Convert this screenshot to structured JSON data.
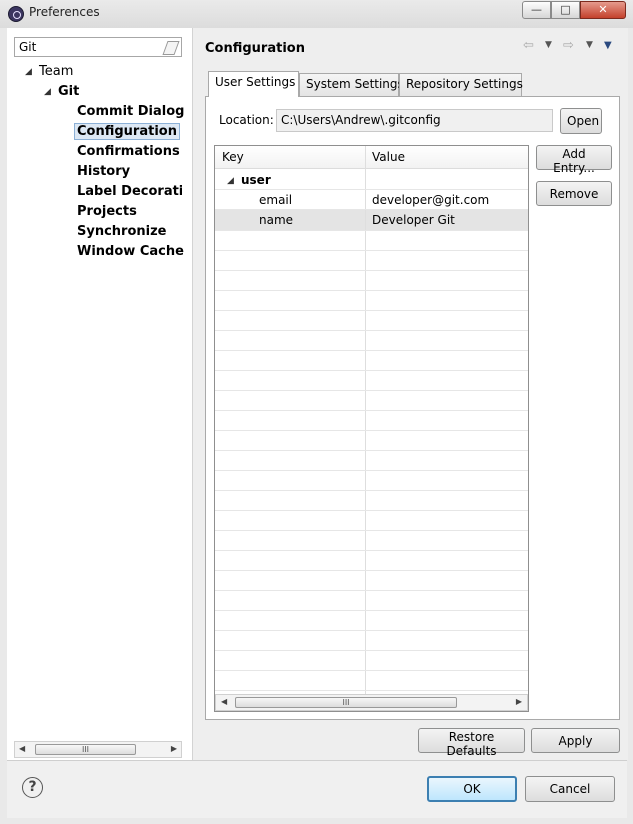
{
  "window": {
    "title": "Preferences",
    "controls": {
      "minimize": "—",
      "maximize": "□",
      "close": "✕"
    }
  },
  "sidebar": {
    "filter_value": "Git",
    "tree": [
      {
        "label": "Team",
        "level": 0,
        "expanded": true
      },
      {
        "label": "Git",
        "level": 1,
        "expanded": true
      },
      {
        "label": "Commit Dialog",
        "level": 2
      },
      {
        "label": "Configuration",
        "level": 2,
        "selected": true
      },
      {
        "label": "Confirmations ar",
        "level": 2
      },
      {
        "label": "History",
        "level": 2
      },
      {
        "label": "Label Decoration",
        "level": 2
      },
      {
        "label": "Projects",
        "level": 2
      },
      {
        "label": "Synchronize",
        "level": 2
      },
      {
        "label": "Window Cache",
        "level": 2
      }
    ],
    "scroll_thumb": "III"
  },
  "page": {
    "title": "Configuration",
    "nav_icons": [
      "back-arrow-icon",
      "dropdown-icon",
      "forward-arrow-icon",
      "dropdown-icon",
      "view-menu-icon"
    ]
  },
  "tabs": [
    {
      "label": "User Settings",
      "active": true
    },
    {
      "label": "System Settings"
    },
    {
      "label": "Repository Settings"
    }
  ],
  "location": {
    "label": "Location:",
    "value": "C:\\Users\\Andrew\\.gitconfig",
    "open_button": "Open"
  },
  "table": {
    "columns": [
      "Key",
      "Value"
    ],
    "rows": [
      {
        "key": "user",
        "value": "",
        "section": true
      },
      {
        "key": "email",
        "value": "developer@git.com"
      },
      {
        "key": "name",
        "value": "Developer Git",
        "selected": true
      }
    ],
    "scroll_thumb": "III"
  },
  "side_buttons": {
    "add": "Add Entry...",
    "remove": "Remove"
  },
  "footer": {
    "restore": "Restore Defaults",
    "apply": "Apply",
    "ok": "OK",
    "cancel": "Cancel",
    "help": "?"
  }
}
